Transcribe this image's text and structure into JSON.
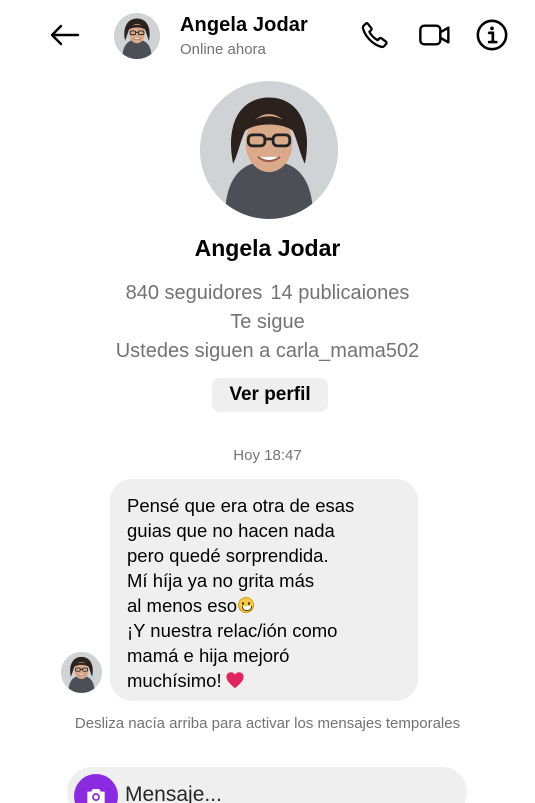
{
  "header": {
    "title": "Angela Jodar",
    "status": "Online ahora",
    "icons": [
      "back-arrow-icon",
      "phone-icon",
      "video-camera-icon",
      "info-icon"
    ]
  },
  "profile": {
    "name": "Angela Jodar",
    "followers": "840 seguidores",
    "posts": "14 publicaiones",
    "follows_you": "Te sigue",
    "mutual": "Ustedes siguen a carla_mama502",
    "view_profile_label": "Ver perfil"
  },
  "conversation": {
    "timestamp": "Hoy 18:47",
    "message_lines": [
      "Pensé que era otra de esas",
      "guias que no hacen nada",
      "pero quedé sorprendida.",
      "Mí híja ya no grita más",
      "al menos eso",
      "¡Y nuestra relac/ión como",
      "mamá e hija mejoró",
      "muchísimo!"
    ],
    "emojis": [
      "grinning-face",
      "red-heart"
    ]
  },
  "footer": {
    "ephemeral_hint": "Desliza nacía arriba para activar los mensajes temporales",
    "composer_placeholder": "Mensaje..."
  },
  "colors": {
    "accent_purple": "#8a2be2",
    "bubble_bg": "#efefef",
    "secondary_text": "#737373",
    "heart": "#e0245e"
  }
}
